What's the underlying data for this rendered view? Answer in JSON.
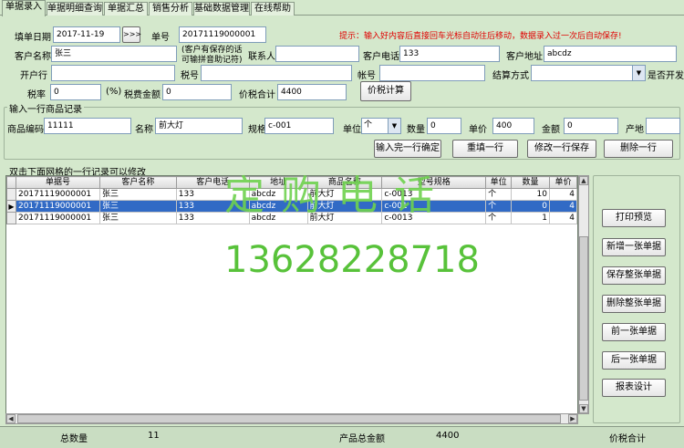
{
  "tabs": [
    "单据录入",
    "单据明细查询",
    "单据汇总",
    "销售分析",
    "基础数据管理",
    "在线帮助"
  ],
  "header": {
    "date_label": "填单日期",
    "date_value": "2017-11-19",
    "nav_button": ">>>",
    "bill_no_label": "单号",
    "bill_no_value": "20171119000001",
    "hint": "提示：输入好内容后直接回车光标自动往后移动，数据录入过一次后自动保存!",
    "customer_label": "客户名称",
    "customer_value": "张三",
    "customer_note_line1": "(客户有保存的话",
    "customer_note_line2": "可输拼音助记符)",
    "contact_label": "联系人",
    "contact_value": "",
    "phone_label": "客户电话",
    "phone_value": "133",
    "address_label": "客户地址",
    "address_value": "abcdz",
    "bank_label": "开户行",
    "bank_value": "",
    "tax_no_label": "税号",
    "tax_no_value": "",
    "account_label": "帐号",
    "account_value": "",
    "settle_label": "结算方式",
    "settle_value": "",
    "invoice_label": "是否开发票",
    "tax_rate_label": "税率",
    "tax_rate_value": "0",
    "percent": "(%)",
    "tax_amount_label": "税费金额",
    "tax_amount_value": "0",
    "total_label": "价税合计",
    "total_value": "4400",
    "calc_button": "价税计算"
  },
  "item_entry": {
    "title": "输入一行商品记录",
    "code_label": "商品编码",
    "code_value": "11111",
    "name_label": "名称",
    "name_value": "前大灯",
    "spec_label": "规格",
    "spec_value": "c-001",
    "unit_label": "单位",
    "unit_value": "个",
    "qty_label": "数量",
    "qty_value": "0",
    "price_label": "单价",
    "price_value": "400",
    "amount_label": "金额",
    "amount_value": "0",
    "origin_label": "产地",
    "origin_value": "",
    "buttons": [
      "输入完一行确定",
      "重填一行",
      "修改一行保存",
      "删除一行"
    ]
  },
  "grid": {
    "hint": "双击下面网格的一行记录可以修改",
    "columns": [
      "单据号",
      "客户名称",
      "客户电话",
      "地址",
      "商品名称",
      "型号规格",
      "单位",
      "数量",
      "单价"
    ],
    "rows": [
      [
        "20171119000001",
        "张三",
        "133",
        "abcdz",
        "前大灯",
        "c-0013",
        "个",
        "10",
        "4"
      ],
      [
        "20171119000001",
        "张三",
        "133",
        "abcdz",
        "前大灯",
        "c-001",
        "个",
        "0",
        "4"
      ],
      [
        "20171119000001",
        "张三",
        "133",
        "abcdz",
        "前大灯",
        "c-0013",
        "个",
        "1",
        "4"
      ]
    ],
    "selected_row": 1
  },
  "side_buttons": [
    "打印预览",
    "新增一张单据",
    "保存整张单据",
    "删除整张单据",
    "前一张单据",
    "后一张单据",
    "报表设计"
  ],
  "watermark": {
    "line1": "定购电话",
    "line2": "13628228718"
  },
  "status": {
    "total_qty_label": "总数量",
    "total_qty_value": "11",
    "product_total_label": "产品总金额",
    "product_total_value": "4400",
    "tax_total_label": "价税合计"
  }
}
